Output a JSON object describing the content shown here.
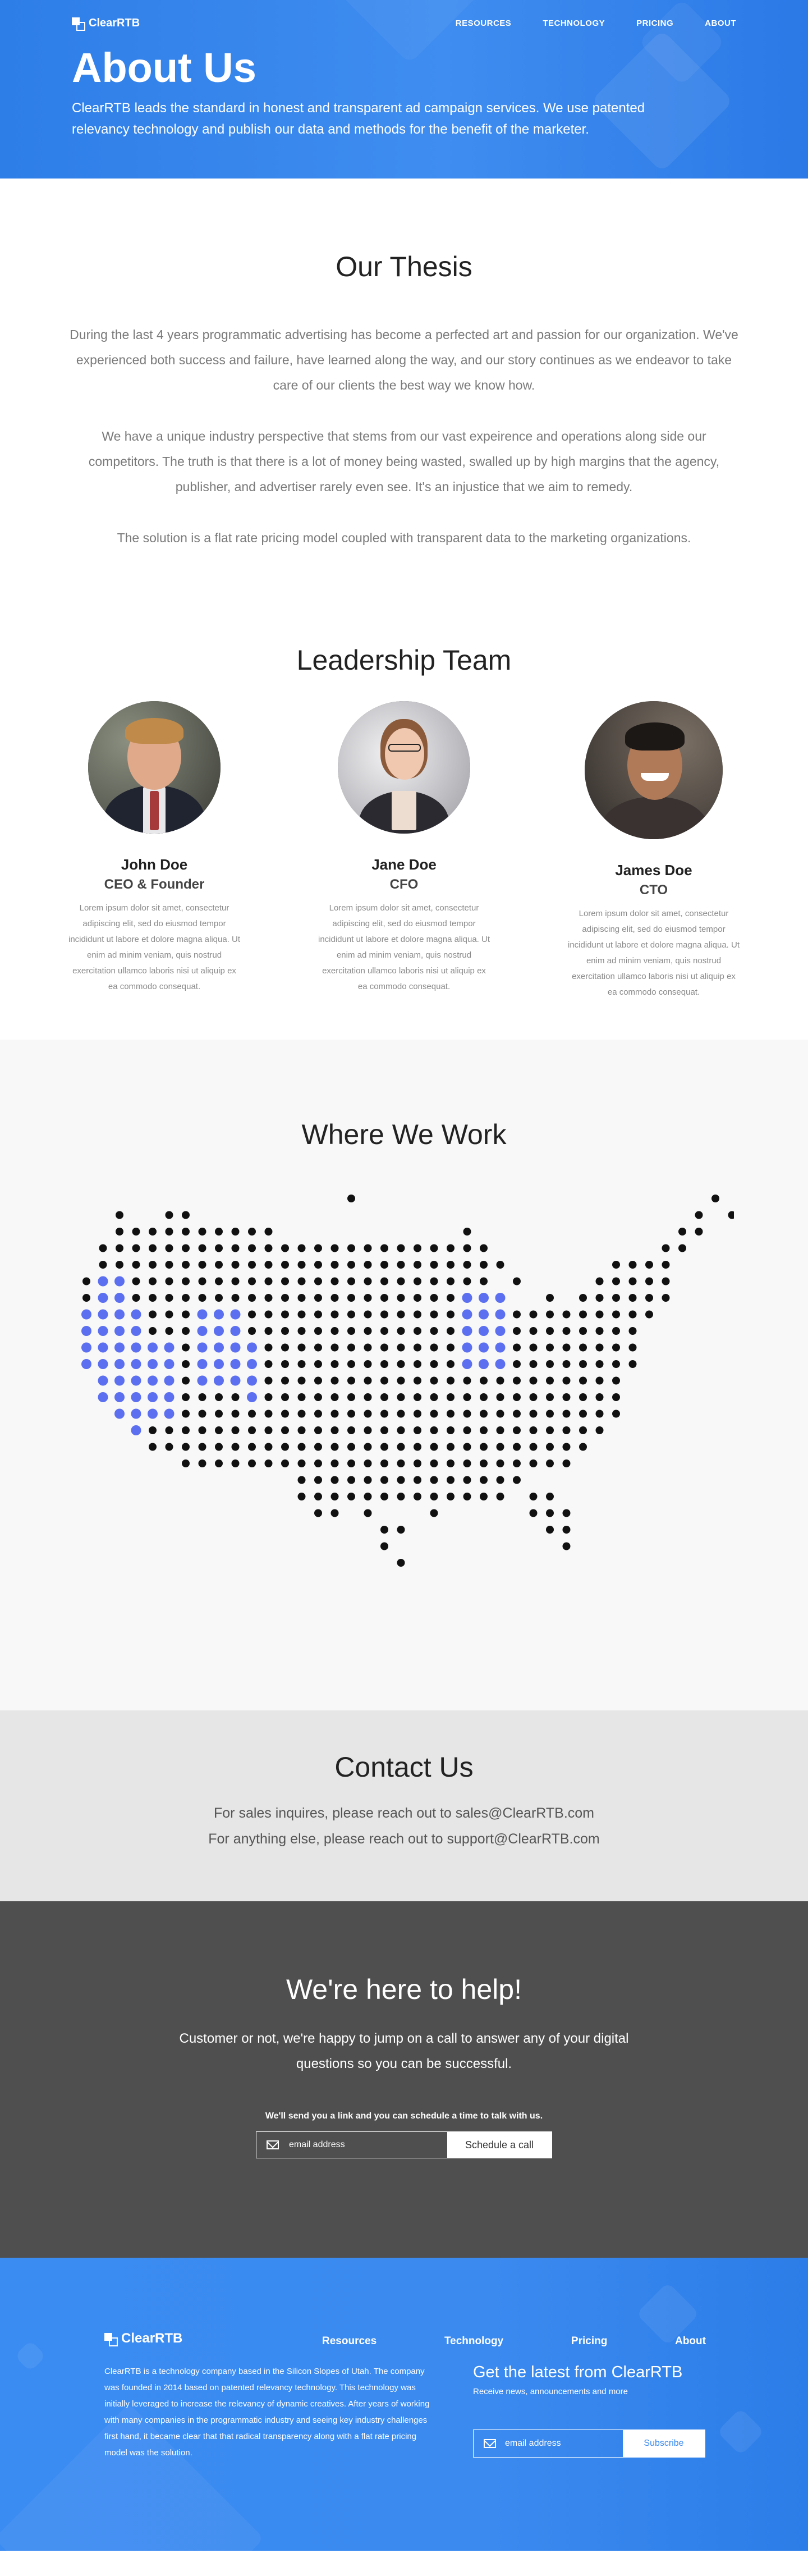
{
  "brand": {
    "name": "ClearRTB"
  },
  "nav": {
    "items": [
      "RESOURCES",
      "TECHNOLOGY",
      "PRICING",
      "ABOUT"
    ]
  },
  "hero": {
    "title": "About Us",
    "text": "ClearRTB leads the standard in honest and transparent ad campaign services. We use patented relevancy technology and publish our data and methods for the benefit of the marketer."
  },
  "thesis": {
    "title": "Our Thesis",
    "paragraphs": [
      "During the last 4 years programmatic advertising has become a perfected art and passion for our organization. We've experienced both success and failure, have learned along the way, and our story continues as we endeavor to take care of our clients the best way we know how.",
      "We have a unique industry perspective that stems from our vast expeirence and operations along side our competitors. The truth is that there is a lot of money being wasted, swalled up by high margins that the agency, publisher, and advertiser rarely even see. It's an injustice that we aim to remedy.",
      "The solution is a flat rate pricing model coupled with transparent data to the marketing organizations."
    ]
  },
  "leadership": {
    "title": "Leadership Team",
    "members": [
      {
        "name": "John Doe",
        "role": "CEO & Founder",
        "bio": "Lorem ipsum dolor sit amet, consectetur adipiscing elit, sed do eiusmod tempor incididunt ut labore et dolore magna aliqua. Ut enim ad minim veniam, quis nostrud exercitation ullamco laboris nisi ut aliquip ex ea commodo consequat."
      },
      {
        "name": "Jane Doe",
        "role": "CFO",
        "bio": "Lorem ipsum dolor sit amet, consectetur adipiscing elit, sed do eiusmod tempor incididunt ut labore et dolore magna aliqua. Ut enim ad minim veniam, quis nostrud exercitation ullamco laboris nisi ut aliquip ex ea commodo consequat."
      },
      {
        "name": "James Doe",
        "role": "CTO",
        "bio": "Lorem ipsum dolor sit amet, consectetur adipiscing elit, sed do eiusmod tempor incididunt ut labore et dolore magna aliqua. Ut enim ad minim veniam, quis nostrud exercitation ullamco laboris nisi ut aliquip ex ea commodo consequat."
      }
    ]
  },
  "work": {
    "title": "Where We Work",
    "colors": {
      "dot": "#111111",
      "highlight": "#5b6ff0"
    }
  },
  "contact": {
    "title": "Contact Us",
    "lines": [
      "For sales inquires, please reach out to sales@ClearRTB.com",
      "For anything else, please reach out to support@ClearRTB.com"
    ]
  },
  "help": {
    "title": "We're here to help!",
    "text": "Customer or not, we're happy to jump on a call to answer any of your digital questions so you can be successful.",
    "hint": "We'll send you a link and you can schedule a time to talk with us.",
    "placeholder": "email address",
    "button": "Schedule a call"
  },
  "footer": {
    "links": [
      "Resources",
      "Technology",
      "Pricing",
      "About"
    ],
    "about": "ClearRTB is a technology company based in the Silicon Slopes of Utah.  The company was founded in 2014 based on patented relevancy technology.  This technology was initially leveraged to increase the relevancy of dynamic creatives.  After years of working with many companies in the programmatic industry and seeing key industry challenges first hand, it became clear that that radical transparency along with a flat rate pricing model was the solution.",
    "newsletter_title": "Get the latest from ClearRTB",
    "newsletter_sub": "Receive news, announcements and more",
    "placeholder": "email address",
    "button": "Subscribe"
  },
  "colors": {
    "brand_blue": "#3a8af0",
    "dark_section": "#4f4f4f",
    "contact_bg": "#e6e6e6"
  }
}
